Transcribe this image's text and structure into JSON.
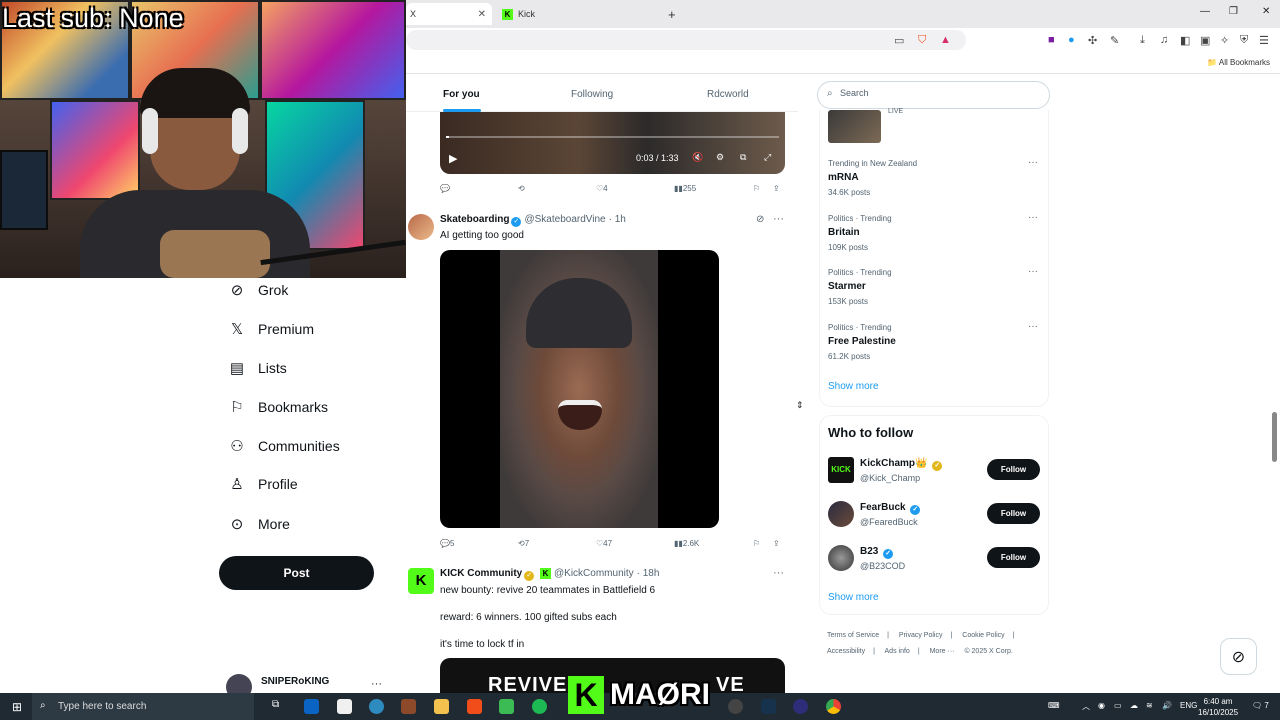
{
  "overlay": {
    "last_sub": "Last sub: None"
  },
  "browser": {
    "tabs": [
      {
        "label": "X"
      },
      {
        "label": "Kick"
      }
    ],
    "new_tab": "+",
    "bookmarks_folder": "All Bookmarks"
  },
  "nav": {
    "items": [
      {
        "label": "Grok",
        "icon": "grok-icon"
      },
      {
        "label": "Premium",
        "icon": "x-logo-icon"
      },
      {
        "label": "Lists",
        "icon": "list-icon"
      },
      {
        "label": "Bookmarks",
        "icon": "bookmark-icon"
      },
      {
        "label": "Communities",
        "icon": "people-icon"
      },
      {
        "label": "Profile",
        "icon": "person-icon"
      },
      {
        "label": "More",
        "icon": "more-circle-icon"
      }
    ],
    "post_label": "Post",
    "account_name": "SNIPERoKING"
  },
  "timeline": {
    "tabs": [
      "For you",
      "Following",
      "Rdcworld"
    ],
    "video": {
      "time": "0:03 / 1:33",
      "progress_fraction": 0.01
    },
    "tweet0_actions": {
      "replies": "",
      "reposts": "",
      "likes": "4",
      "views": "255"
    },
    "tweet1": {
      "name": "Skateboarding",
      "handle": "@SkateboardVine",
      "time": "· 1h",
      "text": "AI getting too good",
      "actions": {
        "replies": "5",
        "reposts": "7",
        "likes": "47",
        "views": "2.6K"
      }
    },
    "tweet2": {
      "name": "KICK Community",
      "handle": "@KickCommunity",
      "time": "· 18h",
      "lines": [
        "new bounty: revive 20 teammates in Battlefield 6",
        "reward: 6 winners. 100 gifted subs each",
        "it's time to lock tf in"
      ],
      "media_text": "REVIVE",
      "media_text2": "VE"
    }
  },
  "sidebar": {
    "search_placeholder": "Search",
    "live_label": "LIVE",
    "trends": [
      {
        "category": "Trending in New Zealand",
        "name": "mRNA",
        "count": "34.6K posts"
      },
      {
        "category": "Politics · Trending",
        "name": "Britain",
        "count": "109K posts"
      },
      {
        "category": "Politics · Trending",
        "name": "Starmer",
        "count": "153K posts"
      },
      {
        "category": "Politics · Trending",
        "name": "Free Palestine",
        "count": "61.2K posts"
      }
    ],
    "show_more": "Show more",
    "who_to_follow": "Who to follow",
    "follow": [
      {
        "name": "KickChamp👑",
        "handle": "@Kick_Champ"
      },
      {
        "name": "FearBuck",
        "handle": "@FearedBuck"
      },
      {
        "name": "B23",
        "handle": "@B23COD"
      }
    ],
    "follow_label": "Follow",
    "show_more2": "Show more",
    "footer": [
      "Terms of Service",
      "|",
      "Privacy Policy",
      "|",
      "Cookie Policy",
      "|",
      "Accessibility",
      "|",
      "Ads info",
      "|",
      "More ···",
      "© 2025 X Corp."
    ]
  },
  "stream_overlay": {
    "kick_text": "MAØRI"
  },
  "taskbar": {
    "search_placeholder": "Type here to search",
    "lang": "ENG",
    "time": "6:40 am",
    "date": "16/10/2025",
    "notifications": "7"
  }
}
